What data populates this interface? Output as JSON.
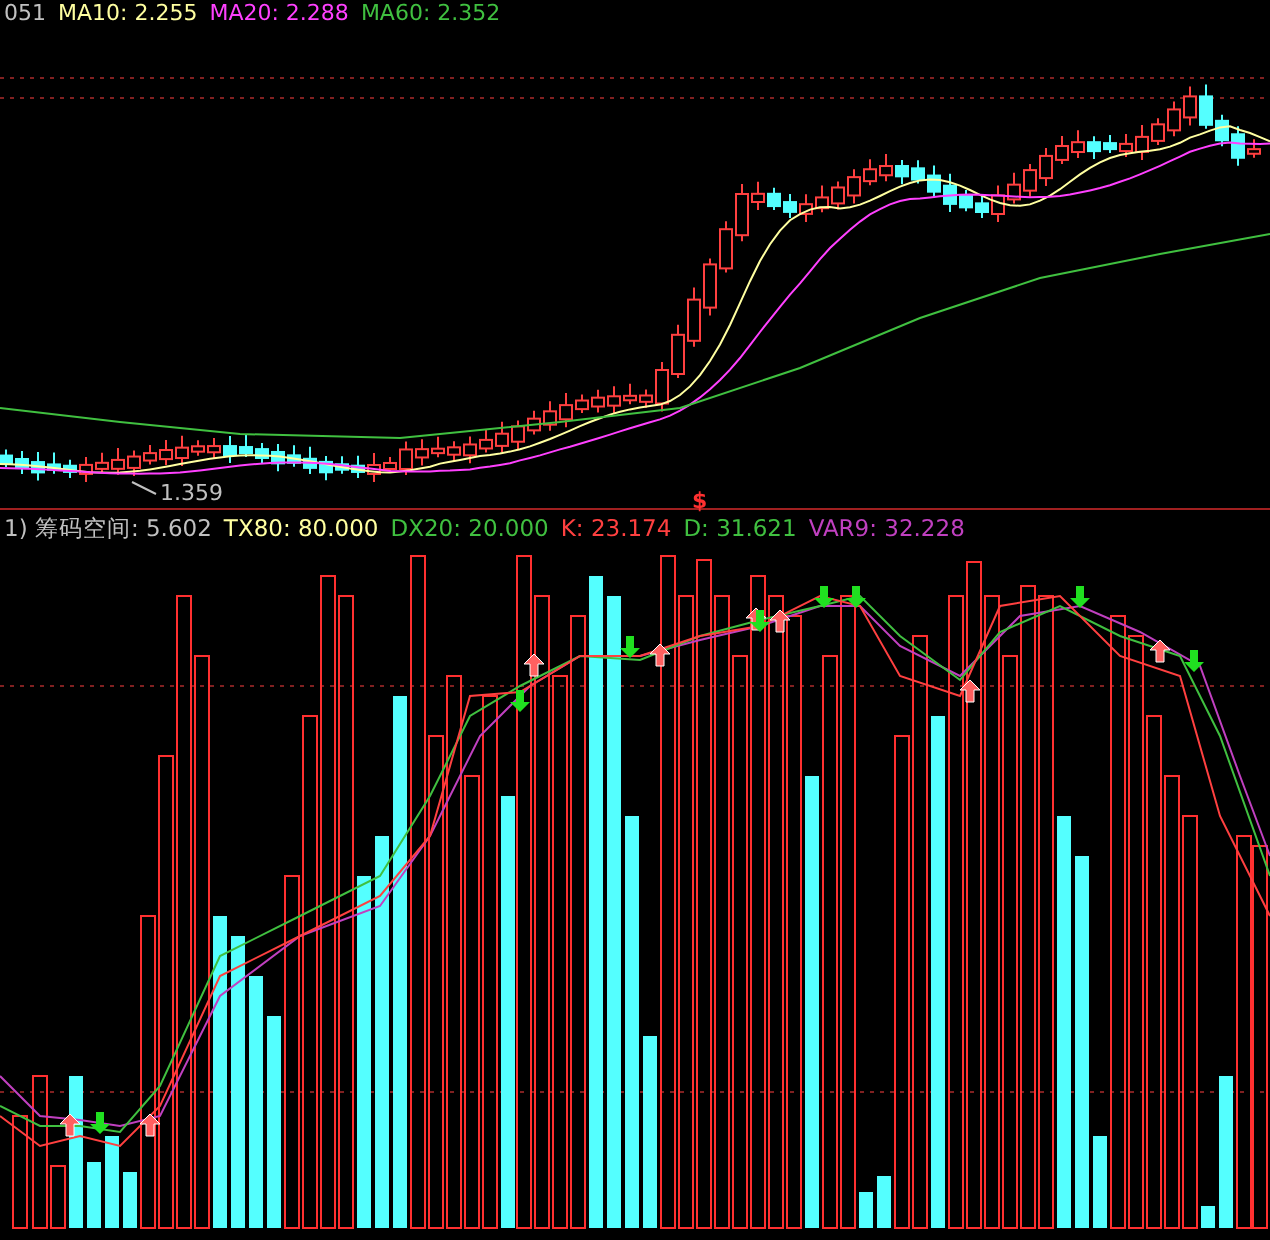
{
  "price_panel": {
    "legend": [
      {
        "text": "051",
        "color": "#c0c0c0"
      },
      {
        "text": "MA10: 2.255",
        "color": "#ffffa0"
      },
      {
        "text": "MA20: 2.288",
        "color": "#ff40ff"
      },
      {
        "text": "MA60: 2.352",
        "color": "#40c040"
      }
    ],
    "low_label": "1.359",
    "marker": "$"
  },
  "indicator_panel": {
    "legend": [
      {
        "text": "1) 筹码空间: 5.602",
        "color": "#c0c0c0"
      },
      {
        "text": "TX80: 80.000",
        "color": "#ffffa0"
      },
      {
        "text": "DX20: 20.000",
        "color": "#40c040"
      },
      {
        "text": "K: 23.174",
        "color": "#ff4040"
      },
      {
        "text": "D: 31.621",
        "color": "#40c040"
      },
      {
        "text": "VAR9: 32.228",
        "color": "#c040c0"
      }
    ]
  }
}
